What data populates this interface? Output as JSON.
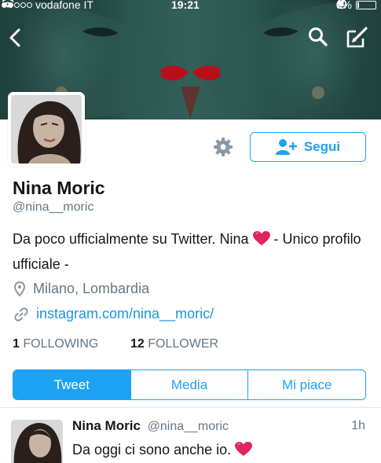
{
  "status_bar": {
    "carrier": "vodafone IT",
    "time": "19:21",
    "battery": "6%",
    "battery_level": 0.06
  },
  "nav": {
    "back_icon": "chevron-left-icon",
    "search_icon": "search-icon",
    "compose_icon": "compose-icon"
  },
  "profile": {
    "name": "Nina Moric",
    "handle": "@nina__moric",
    "bio_text": "Da poco ufficialmente su Twitter. Nina",
    "bio_text_2": " - Unico profilo ufficiale -",
    "location": "Milano, Lombardia",
    "website": "instagram.com/nina__moric/",
    "following_count": "1",
    "following_label": "FOLLOWING",
    "follower_count": "12",
    "follower_label": "FOLLOWER"
  },
  "actions": {
    "follow_label": "Segui"
  },
  "tabs": [
    {
      "label": "Tweet",
      "active": true
    },
    {
      "label": "Media",
      "active": false
    },
    {
      "label": "Mi piace",
      "active": false
    }
  ],
  "tweet": {
    "name": "Nina Moric",
    "handle": "@nina__moric",
    "time": "1h",
    "text": "Da oggi ci sono anche io. "
  },
  "colors": {
    "accent": "#1da1f2",
    "link": "#1b95e0",
    "muted": "#657786",
    "heart": "#e0245e"
  }
}
